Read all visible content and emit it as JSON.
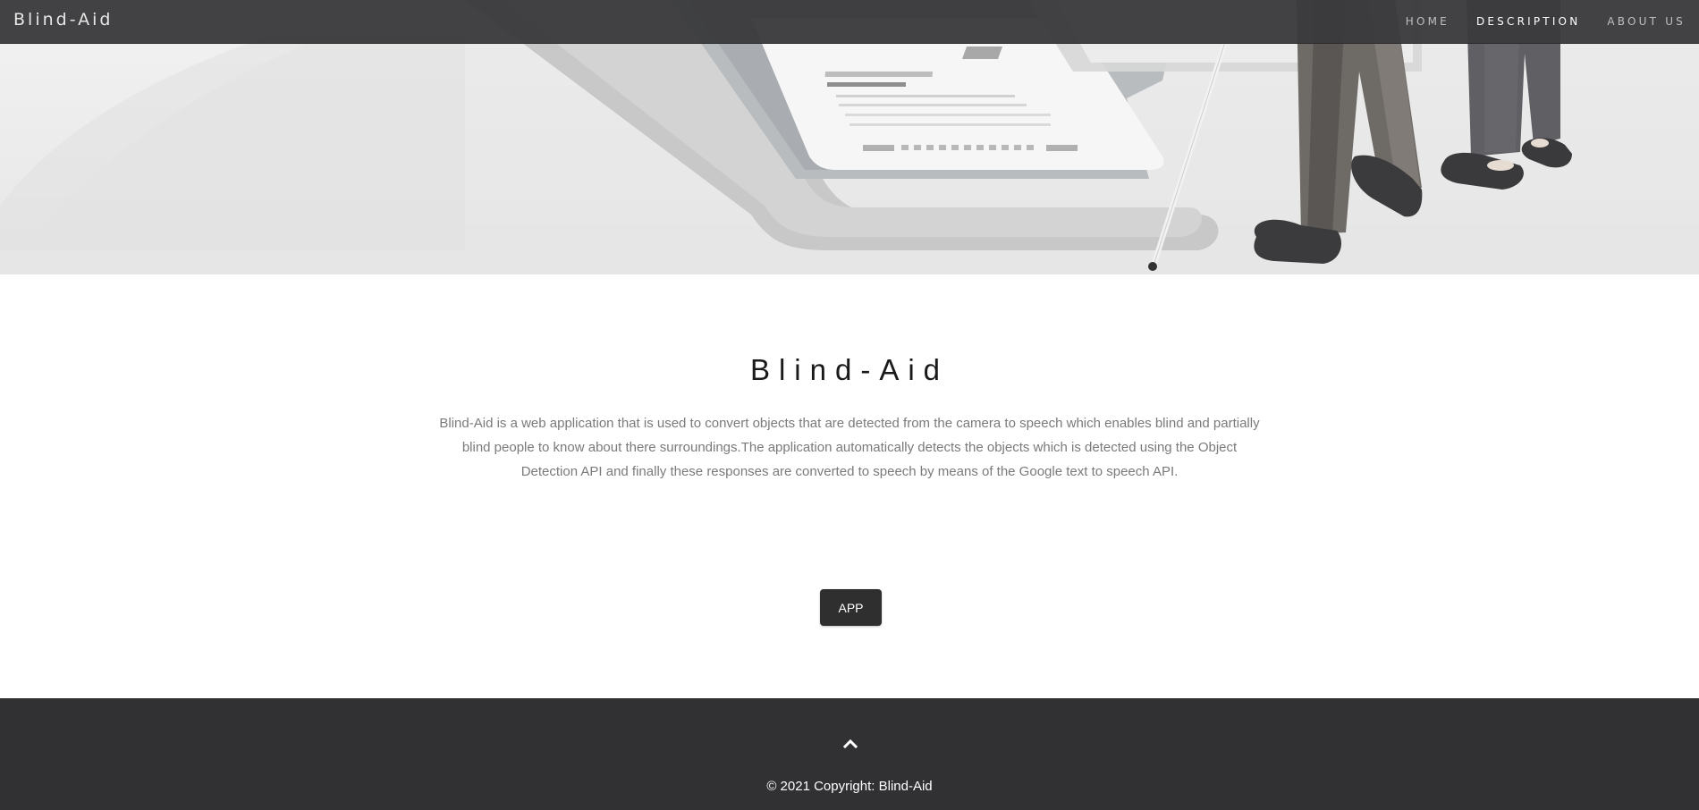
{
  "navbar": {
    "brand": "Blind-Aid",
    "links": [
      {
        "label": "HOME",
        "active": false
      },
      {
        "label": "DESCRIPTION",
        "active": true
      },
      {
        "label": "ABOUT US",
        "active": false
      }
    ]
  },
  "hero": {
    "image": "illustration-person-with-white-cane-beside-laptop"
  },
  "description": {
    "title": "Blind-Aid",
    "text": "Blind-Aid is a web application that is used to convert objects that are detected from the camera to speech which enables blind and partially blind people to know about there surroundings.The application automatically detects the objects which is detected using the Object Detection API and finally these responses are converted to speech by means of the Google text to speech API.",
    "button_label": "APP"
  },
  "footer": {
    "up_icon": "chevron-up-icon",
    "copyright": "© 2021 Copyright: Blind-Aid"
  },
  "colors": {
    "navbar_bg": "#3a3a3c",
    "footer_bg": "#313133",
    "button_bg": "#2f2f2f",
    "body_text": "#7a7a7a"
  }
}
